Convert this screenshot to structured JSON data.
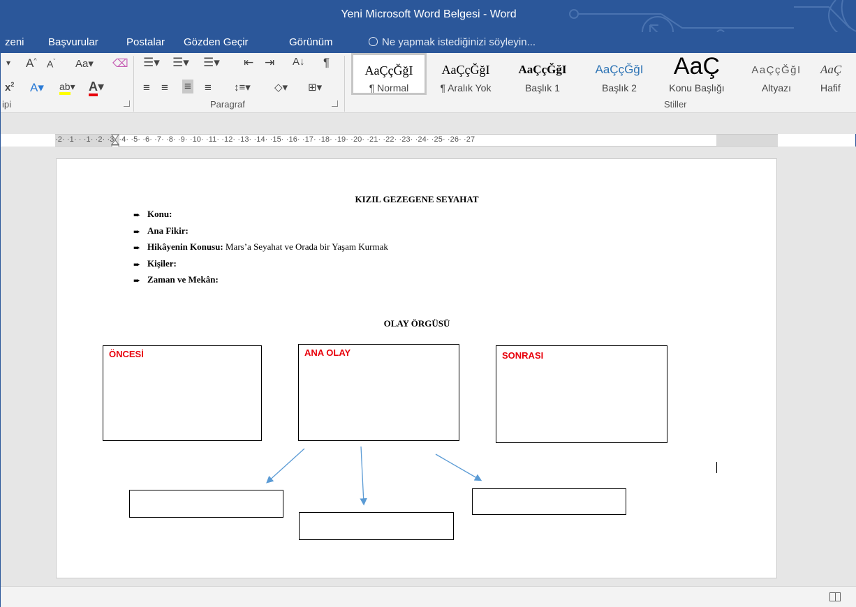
{
  "window": {
    "title": "Yeni Microsoft Word Belgesi - Word"
  },
  "tabs": [
    {
      "label": "zeni"
    },
    {
      "label": "Başvurular"
    },
    {
      "label": "Postalar"
    },
    {
      "label": "Gözden Geçir"
    },
    {
      "label": "Görünüm"
    }
  ],
  "tell_me": {
    "placeholder": "Ne yapmak istediğinizi söyleyin..."
  },
  "ribbon": {
    "font_group_label": "ipi",
    "paragraph_group_label": "Paragraf",
    "styles_group_label": "Stiller",
    "styles": [
      {
        "preview": "AaÇçĞğI",
        "name": "¶ Normal"
      },
      {
        "preview": "AaÇçĞğI",
        "name": "¶ Aralık Yok"
      },
      {
        "preview": "AaÇçĞğI",
        "name": "Başlık 1"
      },
      {
        "preview": "AaÇçĞğI",
        "name": "Başlık 2"
      },
      {
        "preview": "AaÇ",
        "name": "Konu Başlığı"
      },
      {
        "preview": "AaÇçĞğI",
        "name": "Altyazı"
      },
      {
        "preview": "AaÇ",
        "name": "Hafif"
      }
    ]
  },
  "ruler": {
    "numbers": "·2·  ·1·  ·      ·1·  ·2·  ·3·  ·4·  ·5·  ·6·  ·7·  ·8·  ·9·  ·10·  ·11·  ·12·  ·13·  ·14·  ·15·  ·16·  ·17·  ·18·  ·19·  ·20·  ·21·  ·22·  ·23·  ·24·  ·25·  ·26·  ·27"
  },
  "document": {
    "title": "KIZIL GEZEGENE SEYAHAT",
    "items": [
      {
        "label": "Konu:",
        "value": ""
      },
      {
        "label": "Ana Fikir:",
        "value": ""
      },
      {
        "label": "Hikâyenin Konusu:",
        "value": " Mars’a Seyahat ve Orada bir Yaşam Kurmak"
      },
      {
        "label": "Kişiler:",
        "value": ""
      },
      {
        "label": "Zaman ve Mekân:",
        "value": ""
      }
    ],
    "plot_title": "OLAY ÖRGÜSÜ",
    "boxes": {
      "before": "ÖNCESİ",
      "main_event": "ANA OLAY",
      "after": "SONRASI"
    }
  },
  "colors": {
    "titlebar": "#2b579a",
    "box_label": "#e8000b",
    "arrow": "#5b9bd5"
  }
}
